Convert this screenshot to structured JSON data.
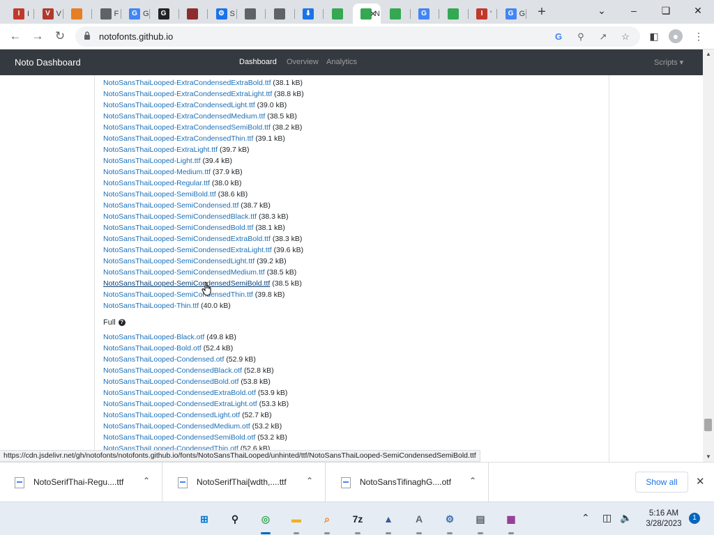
{
  "browser": {
    "tabs": [
      {
        "label": "I",
        "icon": "red-logo-icon",
        "color": "#c0392b",
        "text": "I"
      },
      {
        "label": "V",
        "icon": "wr-app-icon",
        "color": "#b03a2e",
        "text": "V"
      },
      {
        "label": "",
        "icon": "bee-icon",
        "color": "#e67e22",
        "text": ""
      },
      {
        "label": "F",
        "icon": "github-icon",
        "color": "#5f6368",
        "text": ""
      },
      {
        "label": "G",
        "icon": "google-icon",
        "color": "#4285f4",
        "text": "G"
      },
      {
        "label": "",
        "icon": "google-dark-icon",
        "color": "#202124",
        "text": "G"
      },
      {
        "label": "",
        "icon": "book-icon",
        "color": "#8e2d2d",
        "text": ""
      },
      {
        "label": "S",
        "icon": "gear-icon",
        "color": "#1a73e8",
        "text": "⚙"
      },
      {
        "label": "",
        "icon": "chromium-icon",
        "color": "#5f6368",
        "text": ""
      },
      {
        "label": "",
        "icon": "chromium-icon",
        "color": "#5f6368",
        "text": ""
      },
      {
        "label": "",
        "icon": "download-icon",
        "color": "#1a73e8",
        "text": "⬇"
      },
      {
        "label": "",
        "icon": "noto-icon",
        "color": "#34a853",
        "text": ""
      },
      {
        "label": "N",
        "icon": "noto-icon",
        "color": "#34a853",
        "text": ""
      },
      {
        "label": "",
        "icon": "noto-icon",
        "color": "#34a853",
        "text": ""
      },
      {
        "label": "",
        "icon": "google-icon",
        "color": "#4285f4",
        "text": "G"
      },
      {
        "label": "",
        "icon": "noto-icon",
        "color": "#34a853",
        "text": ""
      },
      {
        "label": "'",
        "icon": "red-logo-icon",
        "color": "#c0392b",
        "text": "I"
      },
      {
        "label": "G",
        "icon": "google-icon",
        "color": "#4285f4",
        "text": "G"
      }
    ],
    "url": "notofonts.github.io",
    "status_url": "https://cdn.jsdelivr.net/gh/notofonts/notofonts.github.io/fonts/NotoSansThaiLooped/unhinted/ttf/NotoSansThaiLooped-SemiCondensedSemiBold.ttf"
  },
  "site": {
    "brand": "Noto Dashboard",
    "nav": {
      "dashboard": "Dashboard",
      "overview": "Overview",
      "analytics": "Analytics"
    },
    "scripts": "Scripts ▾",
    "files_ttf": [
      {
        "name": "NotoSansThaiLooped-ExtraCondensedExtraBold.ttf",
        "size": "(38.1 kB)"
      },
      {
        "name": "NotoSansThaiLooped-ExtraCondensedExtraLight.ttf",
        "size": "(38.8 kB)"
      },
      {
        "name": "NotoSansThaiLooped-ExtraCondensedLight.ttf",
        "size": "(39.0 kB)"
      },
      {
        "name": "NotoSansThaiLooped-ExtraCondensedMedium.ttf",
        "size": "(38.5 kB)"
      },
      {
        "name": "NotoSansThaiLooped-ExtraCondensedSemiBold.ttf",
        "size": "(38.2 kB)"
      },
      {
        "name": "NotoSansThaiLooped-ExtraCondensedThin.ttf",
        "size": "(39.1 kB)"
      },
      {
        "name": "NotoSansThaiLooped-ExtraLight.ttf",
        "size": "(39.7 kB)"
      },
      {
        "name": "NotoSansThaiLooped-Light.ttf",
        "size": "(39.4 kB)"
      },
      {
        "name": "NotoSansThaiLooped-Medium.ttf",
        "size": "(37.9 kB)"
      },
      {
        "name": "NotoSansThaiLooped-Regular.ttf",
        "size": "(38.0 kB)"
      },
      {
        "name": "NotoSansThaiLooped-SemiBold.ttf",
        "size": "(38.6 kB)"
      },
      {
        "name": "NotoSansThaiLooped-SemiCondensed.ttf",
        "size": "(38.7 kB)"
      },
      {
        "name": "NotoSansThaiLooped-SemiCondensedBlack.ttf",
        "size": "(38.3 kB)"
      },
      {
        "name": "NotoSansThaiLooped-SemiCondensedBold.ttf",
        "size": "(38.1 kB)"
      },
      {
        "name": "NotoSansThaiLooped-SemiCondensedExtraBold.ttf",
        "size": "(38.3 kB)"
      },
      {
        "name": "NotoSansThaiLooped-SemiCondensedExtraLight.ttf",
        "size": "(39.6 kB)"
      },
      {
        "name": "NotoSansThaiLooped-SemiCondensedLight.ttf",
        "size": "(39.2 kB)"
      },
      {
        "name": "NotoSansThaiLooped-SemiCondensedMedium.ttf",
        "size": "(38.5 kB)"
      },
      {
        "name": "NotoSansThaiLooped-SemiCondensedSemiBold.ttf",
        "size": "(38.5 kB)",
        "hover": true
      },
      {
        "name": "NotoSansThaiLooped-SemiCondensedThin.ttf",
        "size": "(39.8 kB)"
      },
      {
        "name": "NotoSansThaiLooped-Thin.ttf",
        "size": "(40.0 kB)"
      }
    ],
    "full_heading": "Full",
    "files_otf": [
      {
        "name": "NotoSansThaiLooped-Black.otf",
        "size": "(49.8 kB)"
      },
      {
        "name": "NotoSansThaiLooped-Bold.otf",
        "size": "(52.4 kB)"
      },
      {
        "name": "NotoSansThaiLooped-Condensed.otf",
        "size": "(52.9 kB)"
      },
      {
        "name": "NotoSansThaiLooped-CondensedBlack.otf",
        "size": "(52.8 kB)"
      },
      {
        "name": "NotoSansThaiLooped-CondensedBold.otf",
        "size": "(53.8 kB)"
      },
      {
        "name": "NotoSansThaiLooped-CondensedExtraBold.otf",
        "size": "(53.9 kB)"
      },
      {
        "name": "NotoSansThaiLooped-CondensedExtraLight.otf",
        "size": "(53.3 kB)"
      },
      {
        "name": "NotoSansThaiLooped-CondensedLight.otf",
        "size": "(52.7 kB)"
      },
      {
        "name": "NotoSansThaiLooped-CondensedMedium.otf",
        "size": "(53.2 kB)"
      },
      {
        "name": "NotoSansThaiLooped-CondensedSemiBold.otf",
        "size": "(53.2 kB)"
      },
      {
        "name": "NotoSansThaiLooped-CondensedThin.otf",
        "size": "(52.6 kB)"
      }
    ]
  },
  "downloads": {
    "items": [
      {
        "name": "NotoSerifThai-Regu....ttf"
      },
      {
        "name": "NotoSerifThai[wdth,....ttf"
      },
      {
        "name": "NotoSansTifinaghG....otf"
      }
    ],
    "show_all": "Show all"
  },
  "taskbar": {
    "time": "5:16 AM",
    "date": "3/28/2023",
    "notifications": "1",
    "apps": [
      {
        "icon": "windows-start-icon",
        "color": "#0078d4"
      },
      {
        "icon": "search-icon",
        "color": "#202124"
      },
      {
        "icon": "chrome-icon",
        "color": "#34a853",
        "active": true
      },
      {
        "icon": "file-explorer-icon",
        "color": "#f2b01e"
      },
      {
        "icon": "magnifier-app-icon",
        "color": "#e67e22"
      },
      {
        "icon": "7zip-icon",
        "color": "#202124"
      },
      {
        "icon": "inkscape-icon",
        "color": "#3b5998"
      },
      {
        "icon": "font-viewer-icon",
        "color": "#5f6368"
      },
      {
        "icon": "settings-icon",
        "color": "#3c6eb4"
      },
      {
        "icon": "notepad-icon",
        "color": "#5f6368"
      },
      {
        "icon": "winrar-icon",
        "color": "#8e2d8e"
      }
    ]
  }
}
